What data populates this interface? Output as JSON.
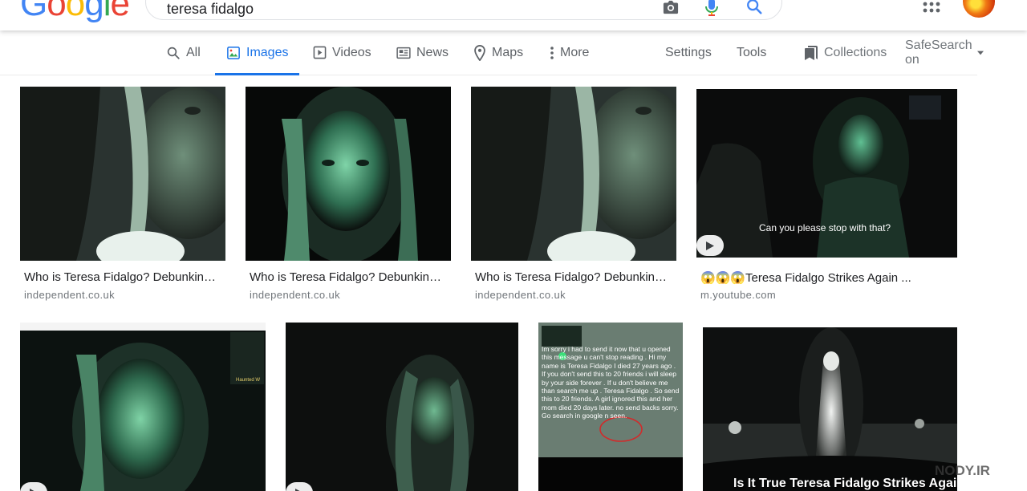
{
  "header": {
    "logo_letters": [
      {
        "ch": "G",
        "color": "#4285F4"
      },
      {
        "ch": "o",
        "color": "#EA4335"
      },
      {
        "ch": "o",
        "color": "#FBBC05"
      },
      {
        "ch": "g",
        "color": "#4285F4"
      },
      {
        "ch": "l",
        "color": "#34A853"
      },
      {
        "ch": "e",
        "color": "#EA4335"
      }
    ],
    "search_query": "teresa fidalgo",
    "icons": [
      "camera-icon",
      "mic-icon",
      "search-icon",
      "apps-icon",
      "avatar"
    ]
  },
  "tabs": [
    {
      "label": "All",
      "icon": "search-icon",
      "active": false
    },
    {
      "label": "Images",
      "icon": "image-icon",
      "active": true
    },
    {
      "label": "Videos",
      "icon": "video-icon",
      "active": false
    },
    {
      "label": "News",
      "icon": "news-icon",
      "active": false
    },
    {
      "label": "Maps",
      "icon": "map-pin-icon",
      "active": false
    },
    {
      "label": "More",
      "icon": "more-vert-icon",
      "active": false
    }
  ],
  "tools": {
    "settings": "Settings",
    "tools": "Tools",
    "collections": "Collections",
    "safesearch": "SafeSearch on"
  },
  "colors": {
    "accent": "#1a73e8",
    "text": "#202124",
    "secondary_text": "#70757a"
  },
  "results": [
    {
      "title": "Who is Teresa Fidalgo? Debunking the ...",
      "source": "independent.co.uk"
    },
    {
      "title": "Who is Teresa Fidalgo? Debunking the ...",
      "source": "independent.co.uk"
    },
    {
      "title": "Who is Teresa Fidalgo? Debunking the ...",
      "source": "independent.co.uk"
    },
    {
      "title": "😱😱😱Teresa Fidalgo Strikes Again ...",
      "source": "m.youtube.com",
      "overlay_caption": "Can you please stop with that?"
    },
    {
      "video": true,
      "overlay_text": "Haunted W"
    },
    {
      "video": true
    },
    {
      "screenshot_text": "Im sorry i had to send it now that u opened this message u can't stop reading . Hi my name is Teresa Fidalgo I died 27 years ago . If you don't send this to 20 friends i will sleep by your side forever . If u don't believe me than search me up . Teresa Fidalgo . So send this to 20 friends. A girl ignored this and her mom died 20 days later. no send backs sorry. Go search in google n seen."
    },
    {
      "overlay_caption": "Is It True Teresa Fidalgo Strikes Again?"
    }
  ],
  "watermark": "NODY.IR"
}
